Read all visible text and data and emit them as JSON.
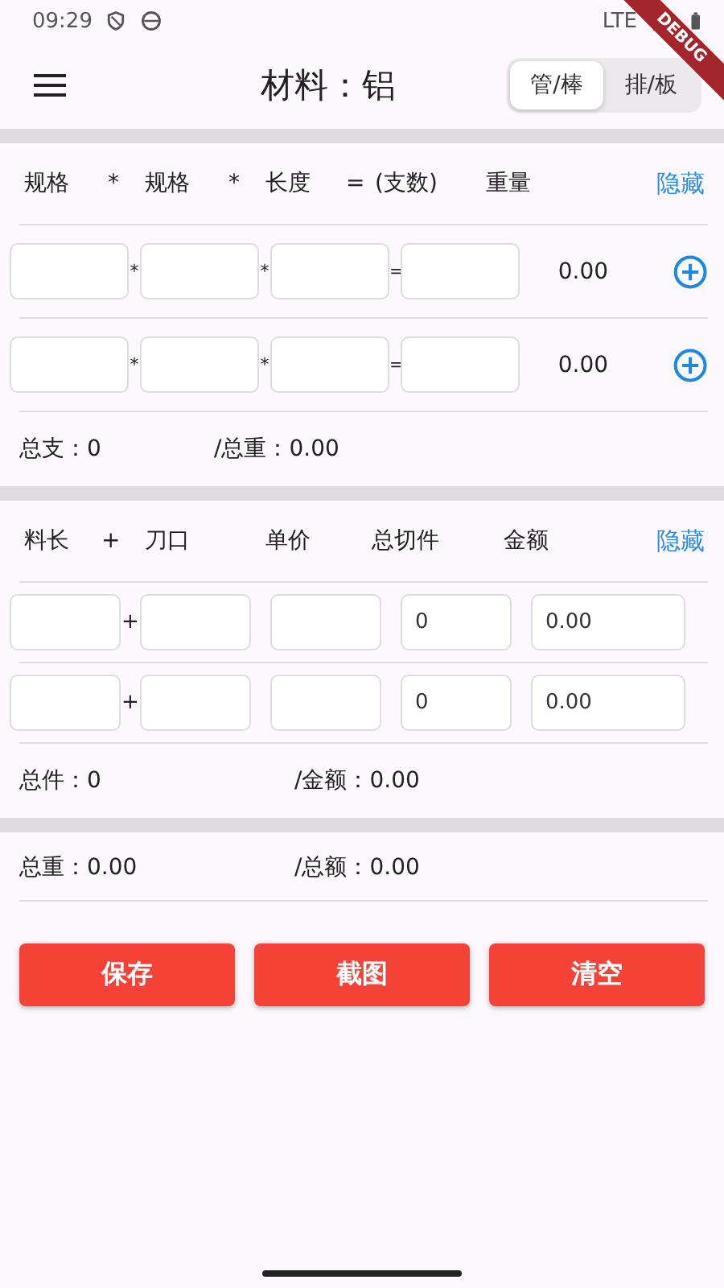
{
  "status_bar": {
    "time": "09:29",
    "network": "LTE"
  },
  "debug_banner": "DEBUG",
  "app_bar": {
    "title": "材料：铝",
    "segments": [
      {
        "label": "管/棒",
        "selected": true
      },
      {
        "label": "排/板",
        "selected": false
      }
    ]
  },
  "weight_section": {
    "headers": [
      "规格",
      "*",
      "规格",
      "*",
      "长度",
      "=",
      "(支数)",
      "重量"
    ],
    "toggle": "隐藏",
    "rows": [
      {
        "operators": [
          "*",
          "*",
          "="
        ],
        "weight": "0.00"
      },
      {
        "operators": [
          "*",
          "*",
          "="
        ],
        "weight": "0.00"
      }
    ],
    "summary": [
      "总支：0",
      "/总重：0.00"
    ]
  },
  "cost_section": {
    "headers": [
      "料长",
      "+",
      "刀口",
      "单价",
      "总切件",
      "金额"
    ],
    "toggle": "隐藏",
    "rows": [
      {
        "operator": "+",
        "total_pieces": "0",
        "amount": "0.00"
      },
      {
        "operator": "+",
        "total_pieces": "0",
        "amount": "0.00"
      }
    ],
    "summary": [
      "总件：0",
      "/金额：0.00"
    ]
  },
  "grand_total": [
    "总重：0.00",
    "/总额：0.00"
  ],
  "buttons": [
    "保存",
    "截图",
    "清空"
  ]
}
